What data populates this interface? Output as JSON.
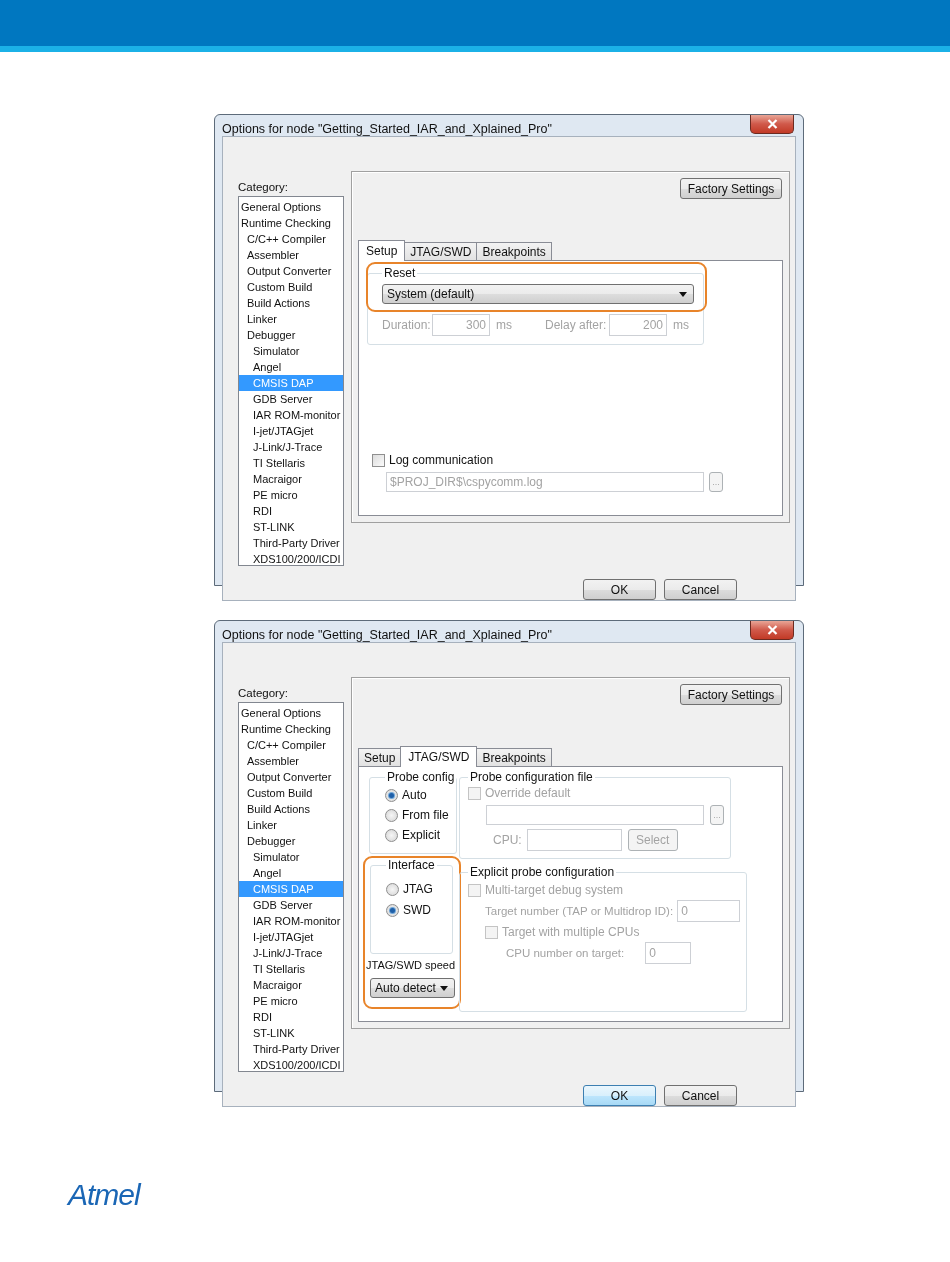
{
  "dialogs": [
    {
      "title": "Options for node \"Getting_Started_IAR_and_Xplained_Pro\"",
      "category_label": "Category:",
      "categories": [
        {
          "label": "General Options",
          "selected": false
        },
        {
          "label": "Runtime Checking",
          "selected": false,
          "children": [
            {
              "label": "C/C++ Compiler",
              "selected": false
            },
            {
              "label": "Assembler",
              "selected": false
            },
            {
              "label": "Output Converter",
              "selected": false
            },
            {
              "label": "Custom Build",
              "selected": false
            },
            {
              "label": "Build Actions",
              "selected": false
            },
            {
              "label": "Linker",
              "selected": false
            },
            {
              "label": "Debugger",
              "selected": false,
              "children": [
                {
                  "label": "Simulator",
                  "selected": false
                },
                {
                  "label": "Angel",
                  "selected": false
                },
                {
                  "label": "CMSIS DAP",
                  "selected": true
                },
                {
                  "label": "GDB Server",
                  "selected": false
                },
                {
                  "label": "IAR ROM-monitor",
                  "selected": false
                },
                {
                  "label": "I-jet/JTAGjet",
                  "selected": false
                },
                {
                  "label": "J-Link/J-Trace",
                  "selected": false
                },
                {
                  "label": "TI Stellaris",
                  "selected": false
                },
                {
                  "label": "Macraigor",
                  "selected": false
                },
                {
                  "label": "PE micro",
                  "selected": false
                },
                {
                  "label": "RDI",
                  "selected": false
                },
                {
                  "label": "ST-LINK",
                  "selected": false
                },
                {
                  "label": "Third-Party Driver",
                  "selected": false
                },
                {
                  "label": "XDS100/200/ICDI",
                  "selected": false
                }
              ]
            }
          ]
        }
      ],
      "factory_button": "Factory Settings",
      "tabs": [
        {
          "label": "Setup",
          "selected": true
        },
        {
          "label": "JTAG/SWD",
          "selected": false
        },
        {
          "label": "Breakpoints",
          "selected": false
        }
      ],
      "page": {
        "kind": "setup",
        "reset": {
          "legend": "Reset",
          "value": "System (default)",
          "highlighted": true
        },
        "timing": [
          {
            "label": "Duration:",
            "value": "300",
            "unit": "ms",
            "disabled": true
          },
          {
            "label": "Delay after:",
            "value": "200",
            "unit": "ms",
            "disabled": true
          }
        ],
        "log": {
          "label": "Log communication",
          "checked": false
        },
        "log_path": {
          "value": "$PROJ_DIR$\\cspycomm.log",
          "disabled": true
        },
        "browse_button": "..."
      },
      "buttons": [
        {
          "label": "OK",
          "focused": false
        },
        {
          "label": "Cancel",
          "focused": false
        }
      ]
    },
    {
      "title": "Options for node \"Getting_Started_IAR_and_Xplained_Pro\"",
      "category_label": "Category:",
      "categories": [
        {
          "label": "General Options",
          "selected": false
        },
        {
          "label": "Runtime Checking",
          "selected": false,
          "children": [
            {
              "label": "C/C++ Compiler",
              "selected": false
            },
            {
              "label": "Assembler",
              "selected": false
            },
            {
              "label": "Output Converter",
              "selected": false
            },
            {
              "label": "Custom Build",
              "selected": false
            },
            {
              "label": "Build Actions",
              "selected": false
            },
            {
              "label": "Linker",
              "selected": false
            },
            {
              "label": "Debugger",
              "selected": false,
              "children": [
                {
                  "label": "Simulator",
                  "selected": false
                },
                {
                  "label": "Angel",
                  "selected": false
                },
                {
                  "label": "CMSIS DAP",
                  "selected": true
                },
                {
                  "label": "GDB Server",
                  "selected": false
                },
                {
                  "label": "IAR ROM-monitor",
                  "selected": false
                },
                {
                  "label": "I-jet/JTAGjet",
                  "selected": false
                },
                {
                  "label": "J-Link/J-Trace",
                  "selected": false
                },
                {
                  "label": "TI Stellaris",
                  "selected": false
                },
                {
                  "label": "Macraigor",
                  "selected": false
                },
                {
                  "label": "PE micro",
                  "selected": false
                },
                {
                  "label": "RDI",
                  "selected": false
                },
                {
                  "label": "ST-LINK",
                  "selected": false
                },
                {
                  "label": "Third-Party Driver",
                  "selected": false
                },
                {
                  "label": "XDS100/200/ICDI",
                  "selected": false
                }
              ]
            }
          ]
        }
      ],
      "factory_button": "Factory Settings",
      "tabs": [
        {
          "label": "Setup",
          "selected": false
        },
        {
          "label": "JTAG/SWD",
          "selected": true
        },
        {
          "label": "Breakpoints",
          "selected": false
        }
      ],
      "page": {
        "kind": "jtag_swd",
        "probe_config": {
          "legend": "Probe config",
          "options": [
            {
              "label": "Auto",
              "selected": true
            },
            {
              "label": "From file",
              "selected": false
            },
            {
              "label": "Explicit",
              "selected": false
            }
          ]
        },
        "interface": {
          "legend": "Interface",
          "highlighted": true,
          "options": [
            {
              "label": "JTAG",
              "selected": false
            },
            {
              "label": "SWD",
              "selected": true
            }
          ],
          "speed_label": "JTAG/SWD speed",
          "speed_value": "Auto detect"
        },
        "probe_file": {
          "legend": "Probe configuration file",
          "disabled": true,
          "override": {
            "label": "Override default",
            "checked": false
          },
          "browse_button": "...",
          "cpu_label": "CPU:",
          "select_button": "Select"
        },
        "explicit": {
          "legend": "Explicit probe configuration",
          "disabled": true,
          "multi_target": {
            "label": "Multi-target debug system",
            "checked": false
          },
          "target_number": {
            "label": "Target number (TAP or Multidrop ID):",
            "value": "0"
          },
          "multiple_cpus": {
            "label": "Target with multiple CPUs",
            "checked": false
          },
          "cpu_number": {
            "label": "CPU number on target:",
            "value": "0"
          }
        }
      },
      "buttons": [
        {
          "label": "OK",
          "focused": true
        },
        {
          "label": "Cancel",
          "focused": false
        }
      ]
    }
  ],
  "logo": "Atmel"
}
